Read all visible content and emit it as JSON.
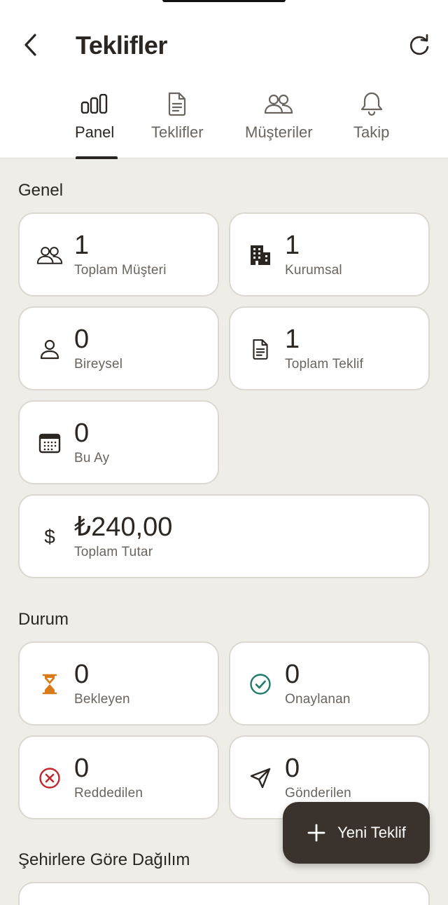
{
  "header": {
    "title": "Teklifler"
  },
  "tabs": [
    {
      "label": "Panel",
      "icon": "bar-chart-icon",
      "active": true
    },
    {
      "label": "Teklifler",
      "icon": "document-icon"
    },
    {
      "label": "Müşteriler",
      "icon": "users-icon"
    },
    {
      "label": "Takip",
      "icon": "bell-icon"
    }
  ],
  "genel": {
    "title": "Genel",
    "cards": [
      {
        "value": "1",
        "label": "Toplam Müşteri",
        "icon": "users-icon"
      },
      {
        "value": "1",
        "label": "Kurumsal",
        "icon": "building-icon"
      },
      {
        "value": "0",
        "label": "Bireysel",
        "icon": "user-icon"
      },
      {
        "value": "1",
        "label": "Toplam Teklif",
        "icon": "document-icon"
      },
      {
        "value": "0",
        "label": "Bu Ay",
        "icon": "calendar-icon"
      },
      {
        "value": "₺240,00",
        "label": "Toplam Tutar",
        "icon": "dollar-icon"
      }
    ]
  },
  "durum": {
    "title": "Durum",
    "cards": [
      {
        "value": "0",
        "label": "Bekleyen",
        "icon": "hourglass-icon",
        "color": "#d97a1a"
      },
      {
        "value": "0",
        "label": "Onaylanan",
        "icon": "check-circle-icon",
        "color": "#1f7a6b"
      },
      {
        "value": "0",
        "label": "Reddedilen",
        "icon": "x-circle-icon",
        "color": "#c0282d"
      },
      {
        "value": "0",
        "label": "Gönderilen",
        "icon": "send-icon"
      }
    ]
  },
  "cities": {
    "title": "Şehirlere Göre Dağılım"
  },
  "fab": {
    "label": "Yeni Teklif",
    "icon": "plus-icon"
  },
  "colors": {
    "accent": "#3a332d",
    "background": "#efede8",
    "card_border": "#dcd8d1"
  }
}
